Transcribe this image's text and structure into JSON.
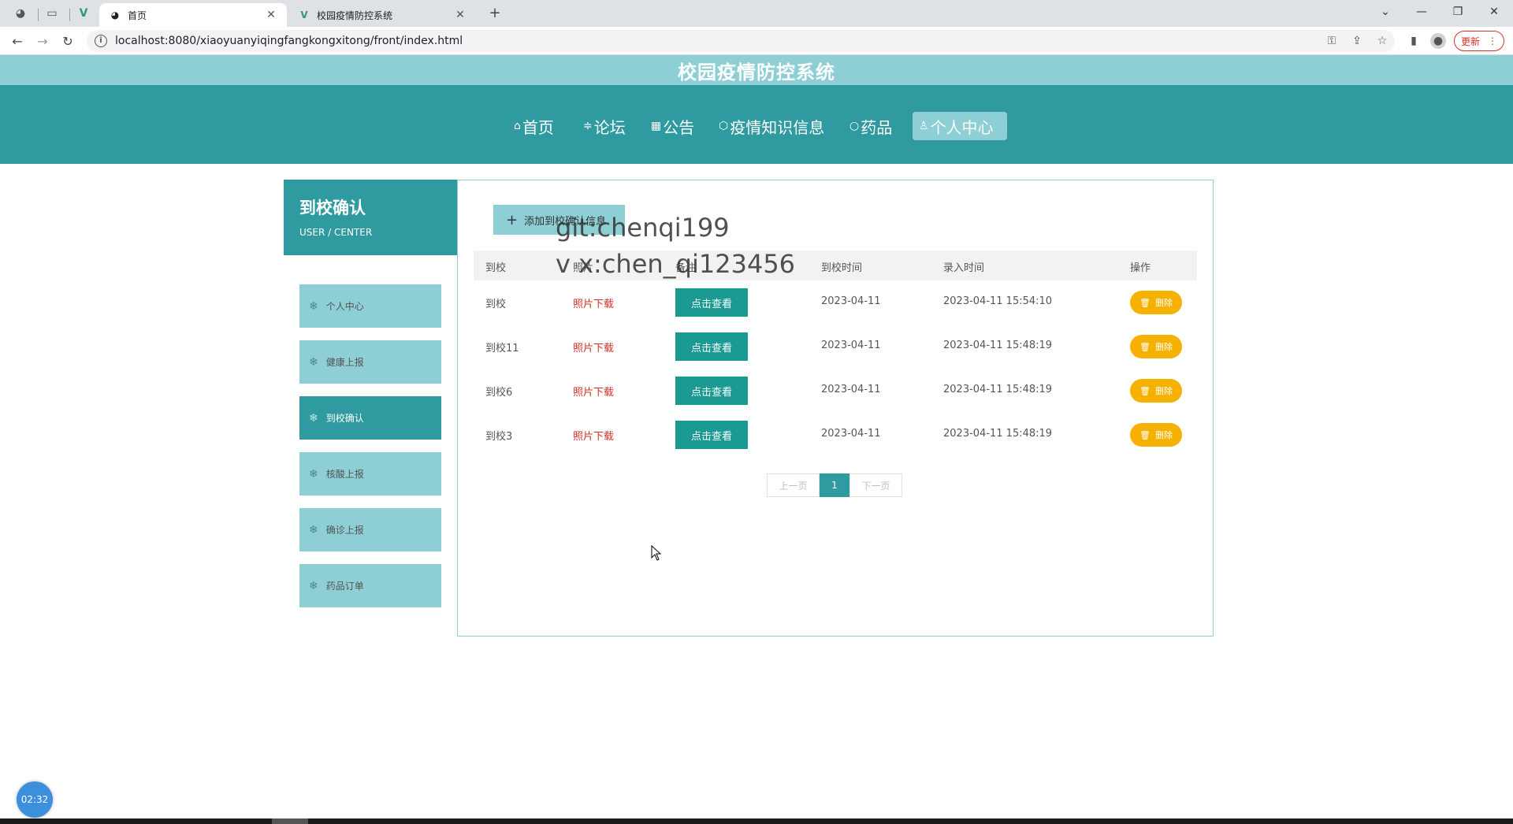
{
  "browser": {
    "tabs": [
      {
        "title": "首页",
        "icon": "globe-icon",
        "active": true
      },
      {
        "title": "校园疫情防控系统",
        "icon": "vue-logo-icon",
        "active": false
      }
    ],
    "url": "localhost:8080/xiaoyuanyiqingfangkongxitong/front/index.html",
    "update_label": "更新",
    "new_tab_label": "+"
  },
  "site": {
    "title": "校园疫情防控系统",
    "nav": [
      {
        "icon": "home-icon",
        "label": "首页"
      },
      {
        "icon": "forum-icon",
        "label": "论坛"
      },
      {
        "icon": "notice-icon",
        "label": "公告"
      },
      {
        "icon": "cube-icon",
        "label": "疫情知识信息"
      },
      {
        "icon": "circle-icon",
        "label": "药品"
      },
      {
        "icon": "user-icon",
        "label": "个人中心",
        "active": true
      }
    ]
  },
  "sidebar": {
    "title": "到校确认",
    "subtitle": "USER / CENTER",
    "items": [
      {
        "label": "个人中心"
      },
      {
        "label": "健康上报"
      },
      {
        "label": "到校确认",
        "active": true
      },
      {
        "label": "核酸上报"
      },
      {
        "label": "确诊上报"
      },
      {
        "label": "药品订单"
      }
    ]
  },
  "main": {
    "add_button_label": "添加到校确认信息",
    "columns": [
      "到校",
      "照片",
      "备注",
      "到校时间",
      "录入时间",
      "操作"
    ],
    "rows": [
      {
        "name": "到校",
        "photo": "照片下载",
        "view": "点击查看",
        "date": "2023-04-11",
        "created": "2023-04-11 15:54:10",
        "delete": "删除"
      },
      {
        "name": "到校11",
        "photo": "照片下载",
        "view": "点击查看",
        "date": "2023-04-11",
        "created": "2023-04-11 15:48:19",
        "delete": "删除"
      },
      {
        "name": "到校6",
        "photo": "照片下载",
        "view": "点击查看",
        "date": "2023-04-11",
        "created": "2023-04-11 15:48:19",
        "delete": "删除"
      },
      {
        "name": "到校3",
        "photo": "照片下载",
        "view": "点击查看",
        "date": "2023-04-11",
        "created": "2023-04-11 15:48:19",
        "delete": "删除"
      }
    ],
    "pager": {
      "prev": "上一页",
      "current": "1",
      "next": "下一页"
    }
  },
  "watermark": {
    "line1": "git:chenqi199",
    "line2": "v x:chen_qi123456"
  },
  "timer": "02:32",
  "colors": {
    "teal_dark": "#2f9a9f",
    "teal_light": "#8ecfd6",
    "view_button": "#1a9a93",
    "delete_button": "#f5b000",
    "download_link": "#d93025"
  }
}
